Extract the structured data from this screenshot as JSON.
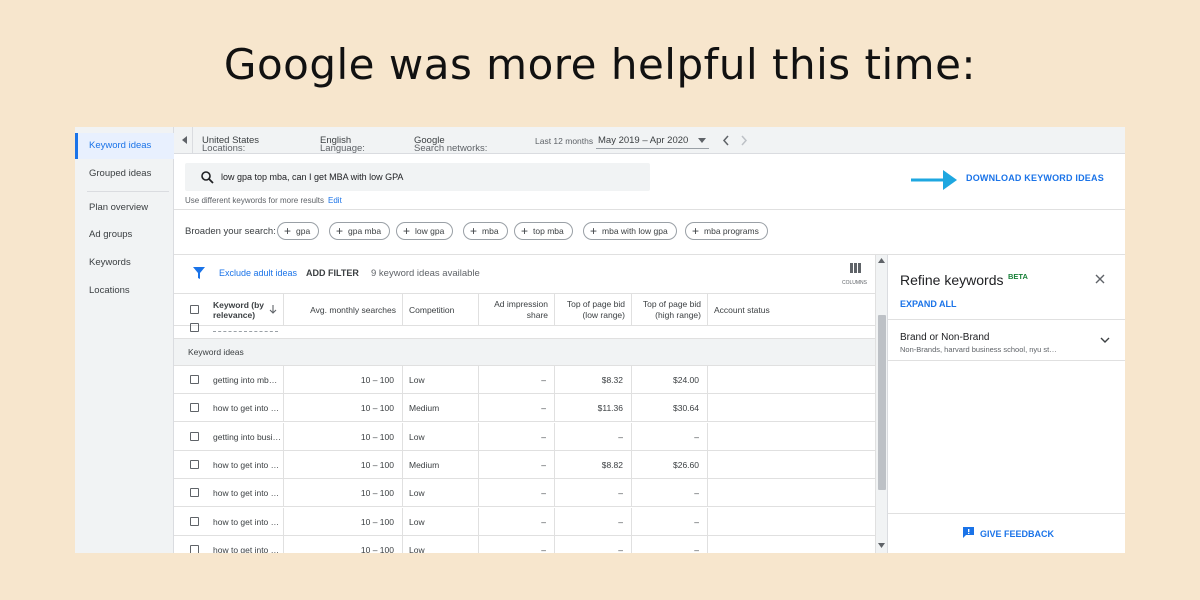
{
  "headline": "Google was more helpful this time:",
  "sidebar": {
    "items": [
      {
        "label": "Keyword ideas",
        "active": true
      },
      {
        "label": "Grouped ideas"
      },
      {
        "label": "Plan overview"
      },
      {
        "label": "Ad groups"
      },
      {
        "label": "Keywords"
      },
      {
        "label": "Locations"
      }
    ]
  },
  "topbar": {
    "locations_label": "Locations:",
    "locations_value": "United States",
    "language_label": "Language:",
    "language_value": "English",
    "networks_label": "Search networks:",
    "networks_value": "Google",
    "period_label": "Last 12 months",
    "period_value": "May 2019 – Apr 2020"
  },
  "search": {
    "query": "low gpa top mba, can I get MBA with low GPA",
    "hint": "Use different keywords for more results",
    "edit_label": "Edit"
  },
  "download_label": "DOWNLOAD KEYWORD IDEAS",
  "broaden": {
    "label": "Broaden your search:",
    "chips": [
      "gpa",
      "gpa mba",
      "low gpa",
      "mba",
      "top mba",
      "mba with low gpa",
      "mba programs"
    ]
  },
  "filters": {
    "exclude_label": "Exclude adult ideas",
    "add_filter_label": "ADD FILTER",
    "count_text": "9 keyword ideas available",
    "columns_label": "COLUMNS"
  },
  "table": {
    "headers": {
      "keyword": "Keyword (by relevance)",
      "searches": "Avg. monthly searches",
      "competition": "Competition",
      "impression": "Ad impression share",
      "bid_low": "Top of page bid (low range)",
      "bid_high": "Top of page bid (high range)",
      "status": "Account status"
    },
    "group_label": "Keyword ideas",
    "rows": [
      {
        "keyword": "getting into mb…",
        "searches": "10 – 100",
        "competition": "Low",
        "impression": "–",
        "bid_low": "$8.32",
        "bid_high": "$24.00"
      },
      {
        "keyword": "how to get into …",
        "searches": "10 – 100",
        "competition": "Medium",
        "impression": "–",
        "bid_low": "$11.36",
        "bid_high": "$30.64"
      },
      {
        "keyword": "getting into busi…",
        "searches": "10 – 100",
        "competition": "Low",
        "impression": "–",
        "bid_low": "–",
        "bid_high": "–"
      },
      {
        "keyword": "how to get into …",
        "searches": "10 – 100",
        "competition": "Medium",
        "impression": "–",
        "bid_low": "$8.82",
        "bid_high": "$26.60"
      },
      {
        "keyword": "how to get into …",
        "searches": "10 – 100",
        "competition": "Low",
        "impression": "–",
        "bid_low": "–",
        "bid_high": "–"
      },
      {
        "keyword": "how to get into …",
        "searches": "10 – 100",
        "competition": "Low",
        "impression": "–",
        "bid_low": "–",
        "bid_high": "–"
      },
      {
        "keyword": "how to get into …",
        "searches": "10 – 100",
        "competition": "Low",
        "impression": "–",
        "bid_low": "–",
        "bid_high": "–"
      }
    ]
  },
  "refine": {
    "title": "Refine keywords",
    "badge": "BETA",
    "expand_all": "EXPAND ALL",
    "filter_name": "Brand or Non-Brand",
    "filter_summary": "Non-Brands, harvard business school, nyu st…",
    "feedback_label": "GIVE FEEDBACK"
  },
  "colors": {
    "accent": "#1a73e8",
    "arrow": "#1ea7e0",
    "background": "#f7e6cd",
    "beta": "#188038"
  }
}
